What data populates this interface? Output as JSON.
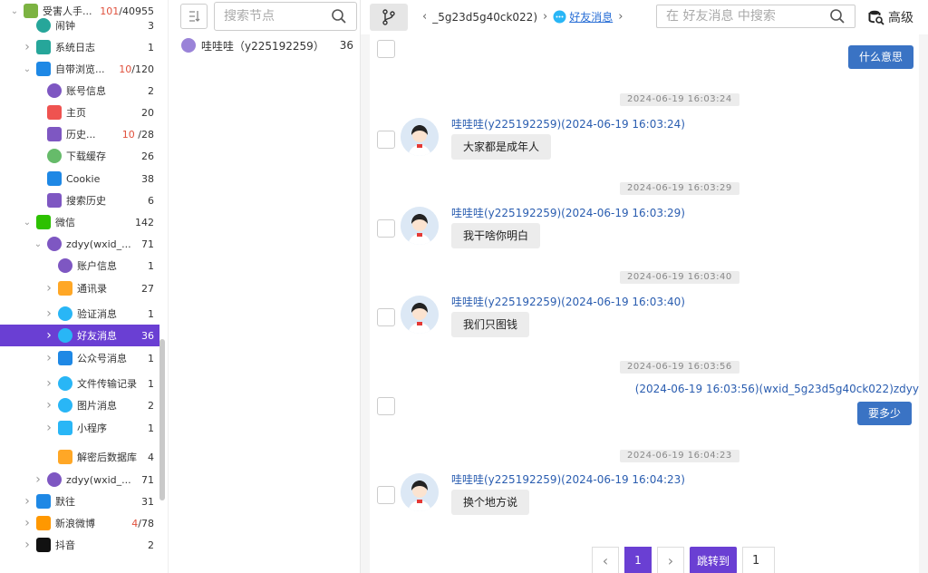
{
  "tree": {
    "items": [
      {
        "label": "受害人手...",
        "count": "101",
        "count_suffix": "/40955",
        "icon": "android-icon",
        "color": "#7cb342",
        "level": 0,
        "arrow": "v"
      },
      {
        "label": "闹钟",
        "count": "3",
        "icon": "clock-icon",
        "color": "#26a69a",
        "level": 1,
        "arrow": ""
      },
      {
        "label": "系统日志",
        "count": "1",
        "icon": "log-icon",
        "color": "#26a69a",
        "level": 1,
        "arrow": ">"
      },
      {
        "label": "自带浏览...",
        "count": "10",
        "count_suffix": "/120",
        "icon": "browser-icon",
        "color": "#1e88e5",
        "level": 1,
        "arrow": "v"
      },
      {
        "label": "账号信息",
        "count": "2",
        "icon": "account-icon",
        "color": "#7e57c2",
        "level": 2,
        "arrow": ""
      },
      {
        "label": "主页",
        "count": "20",
        "icon": "home-icon",
        "color": "#ef5350",
        "level": 2,
        "arrow": ""
      },
      {
        "label": "历史...",
        "count": "10",
        "count_suffix": " /28",
        "icon": "history-icon",
        "color": "#7e57c2",
        "level": 2,
        "arrow": ""
      },
      {
        "label": "下载缓存",
        "count": "26",
        "icon": "download-icon",
        "color": "#66bb6a",
        "level": 2,
        "arrow": ""
      },
      {
        "label": "Cookie",
        "count": "38",
        "icon": "cookie-icon",
        "color": "#1e88e5",
        "level": 2,
        "arrow": ""
      },
      {
        "label": "搜索历史",
        "count": "6",
        "icon": "search-history-icon",
        "color": "#7e57c2",
        "level": 2,
        "arrow": ""
      },
      {
        "label": "微信",
        "count": "142",
        "icon": "wechat-icon",
        "color": "#2dc100",
        "level": 1,
        "arrow": "v"
      },
      {
        "label": "zdyy(wxid_...",
        "count": "71",
        "icon": "user-icon",
        "color": "#7e57c2",
        "level": 2,
        "arrow": "v"
      },
      {
        "label": "账户信息",
        "count": "1",
        "icon": "user-icon",
        "color": "#7e57c2",
        "level": 3,
        "arrow": ""
      },
      {
        "label": "通讯录",
        "count": "27",
        "icon": "contacts-icon",
        "color": "#ffa726",
        "level": 3,
        "arrow": ">"
      },
      {
        "label": "验证消息",
        "count": "1",
        "icon": "chat-bubble-icon",
        "color": "#29b6f6",
        "level": 3,
        "arrow": ">"
      },
      {
        "label": "好友消息",
        "count": "36",
        "icon": "chat-bubble-icon",
        "color": "#29b6f6",
        "level": 3,
        "arrow": ">",
        "active": true
      },
      {
        "label": "公众号消息",
        "count": "1",
        "icon": "official-account-icon",
        "color": "#1e88e5",
        "level": 3,
        "arrow": ">"
      },
      {
        "label": "文件传输记录",
        "count": "1",
        "icon": "chat-bubble-icon",
        "color": "#29b6f6",
        "level": 3,
        "arrow": ">"
      },
      {
        "label": "图片消息",
        "count": "2",
        "icon": "chat-bubble-icon",
        "color": "#29b6f6",
        "level": 3,
        "arrow": ">"
      },
      {
        "label": "小程序",
        "count": "1",
        "icon": "mini-program-icon",
        "color": "#29b6f6",
        "level": 3,
        "arrow": ">"
      },
      {
        "label": "解密后数据库",
        "count": "4",
        "icon": "database-icon",
        "color": "#ffa726",
        "level": 3,
        "arrow": ""
      },
      {
        "label": "zdyy(wxid_...",
        "count": "71",
        "icon": "user-icon",
        "color": "#7e57c2",
        "level": 2,
        "arrow": ">"
      },
      {
        "label": "默往",
        "count": "31",
        "icon": "mowang-icon",
        "color": "#1e88e5",
        "level": 1,
        "arrow": ">"
      },
      {
        "label": "新浪微博",
        "count": "4",
        "count_suffix": "/78",
        "icon": "weibo-icon",
        "color": "#ff9800",
        "level": 1,
        "arrow": ">"
      },
      {
        "label": "抖音",
        "count": "2",
        "icon": "tiktok-icon",
        "color": "#111111",
        "level": 1,
        "arrow": ">"
      }
    ]
  },
  "node_search": {
    "placeholder": "搜索节点"
  },
  "node_list": [
    {
      "label": "哇哇哇（y225192259）",
      "count": "36"
    }
  ],
  "breadcrumb": {
    "path": "_5g23d5g40ck022)",
    "current": "好友消息"
  },
  "message_search": {
    "placeholder": "在 好友消息 中搜索"
  },
  "advanced_label": "高级",
  "messages": [
    {
      "type": "right_bubble",
      "text": "什么意思"
    },
    {
      "type": "time",
      "text": "2024-06-19 16:03:24"
    },
    {
      "type": "left",
      "sender": "哇哇哇(y225192259)(2024-06-19 16:03:24)",
      "text": "大家都是成年人"
    },
    {
      "type": "time",
      "text": "2024-06-19 16:03:29"
    },
    {
      "type": "left",
      "sender": "哇哇哇(y225192259)(2024-06-19 16:03:29)",
      "text": "我干啥你明白"
    },
    {
      "type": "time",
      "text": "2024-06-19 16:03:40"
    },
    {
      "type": "left",
      "sender": "哇哇哇(y225192259)(2024-06-19 16:03:40)",
      "text": "我们只图钱"
    },
    {
      "type": "time",
      "text": "2024-06-19 16:03:56"
    },
    {
      "type": "right",
      "sender": "(2024-06-19 16:03:56)(wxid_5g23d5g40ck022)zdyy",
      "text": "要多少"
    },
    {
      "type": "time",
      "text": "2024-06-19 16:04:23"
    },
    {
      "type": "left",
      "sender": "哇哇哇(y225192259)(2024-06-19 16:04:23)",
      "text": "换个地方说"
    }
  ],
  "pager": {
    "prev": "‹",
    "current_page": "1",
    "next": "›",
    "jump_label": "跳转到",
    "jump_value": "1"
  }
}
